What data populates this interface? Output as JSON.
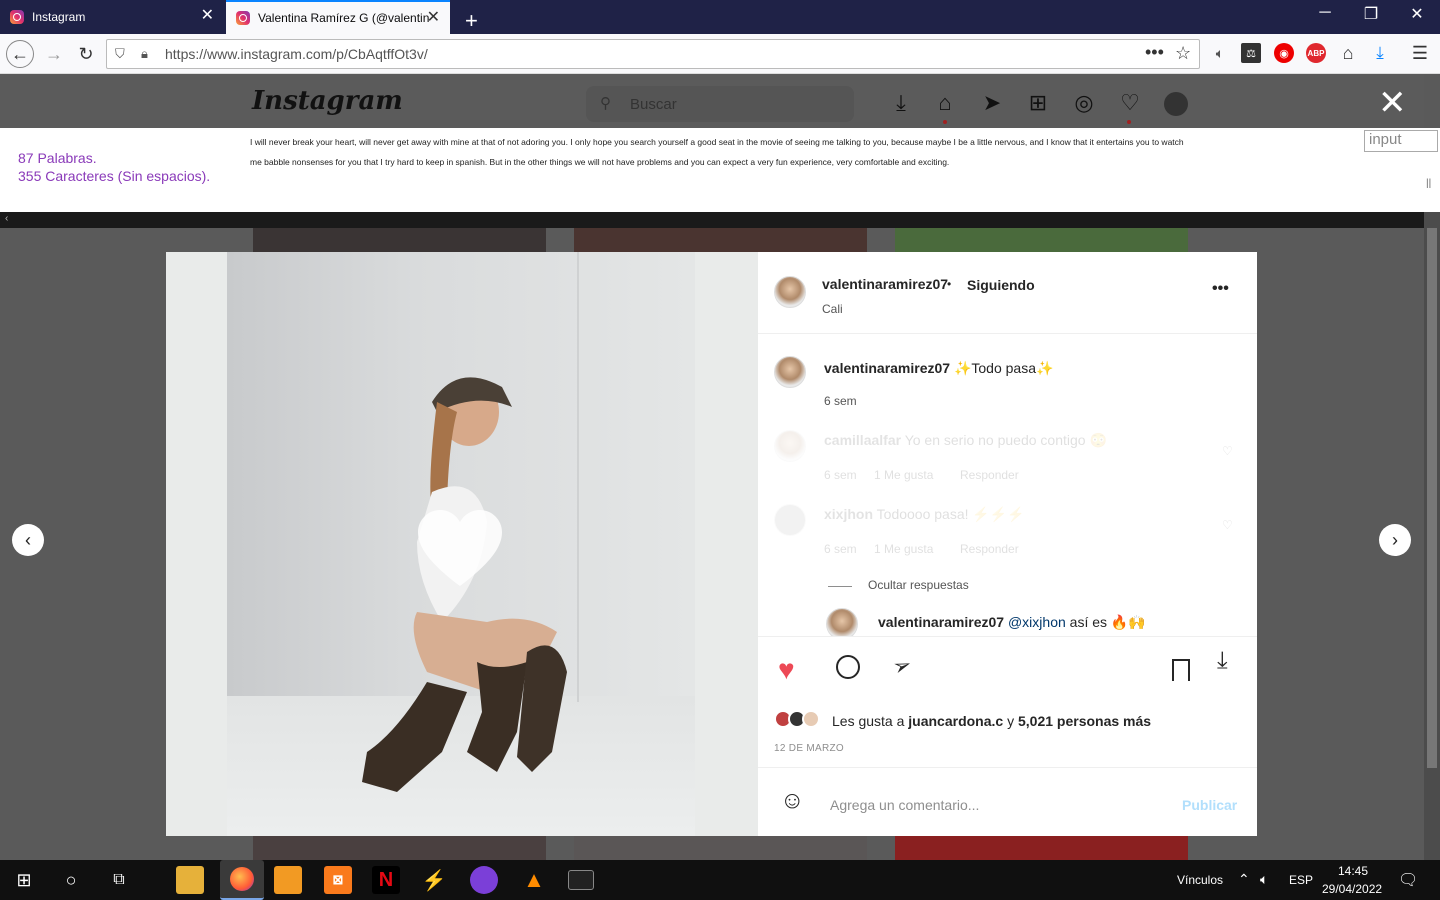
{
  "browser": {
    "tabs": [
      {
        "title": "Instagram"
      },
      {
        "title": "Valentina Ramírez G (@valentin"
      }
    ],
    "url": "https://www.instagram.com/p/CbAqtffOt3v/",
    "new_tab_glyph": "+",
    "close_glyph": "✕"
  },
  "instagram": {
    "logo": "Instagram",
    "search_placeholder": "Buscar"
  },
  "word_counter": {
    "words": "87 Palabras.",
    "chars": "355 Caracteres (Sin espacios).",
    "text_line1": "I will never break your heart, will never get away with mine at that of not adoring you. I only hope you search yourself a good seat in the movie of seeing me talking to you, because maybe I be a little nervous, and I know that it entertains you to watch",
    "text_line2": "me babble nonsenses for you that I try hard to keep in spanish. But in the other things we will not have problems and you can expect a very fun experience, very comfortable and exciting.",
    "input_label": "input",
    "pause_glyph": "||"
  },
  "post": {
    "author": "valentinaramirez07",
    "dot": "•",
    "follow_state": "Siguiendo",
    "location": "Cali",
    "caption": "✨Todo pasa✨",
    "caption_age": "6 sem",
    "comments": [
      {
        "user": "camillaalfar",
        "text": "Yo en serio no puedo contigo 😳",
        "age": "6 sem",
        "likes": "1 Me gusta",
        "reply": "Responder"
      },
      {
        "user": "xixjhon",
        "text": "Todoooo pasa! ⚡⚡⚡",
        "age": "6 sem",
        "likes": "1 Me gusta",
        "reply": "Responder"
      }
    ],
    "hide_replies": "Ocultar respuestas",
    "reply": {
      "user": "valentinaramirez07",
      "mention": "@xixjhon",
      "text": "así es 🔥🙌"
    },
    "likes_prefix": "Les gusta a",
    "likes_user": "juancardona.c",
    "likes_and": "y",
    "likes_count": "5,021 personas más",
    "date": "12 DE MARZO",
    "comment_placeholder": "Agrega un comentario...",
    "publish": "Publicar"
  },
  "taskbar": {
    "links": "Vínculos",
    "lang": "ESP",
    "time": "14:45",
    "date": "29/04/2022"
  },
  "colors": {
    "like": "#ed4956",
    "accent": "#0095f6",
    "counter_purple": "#8a3ab9"
  }
}
